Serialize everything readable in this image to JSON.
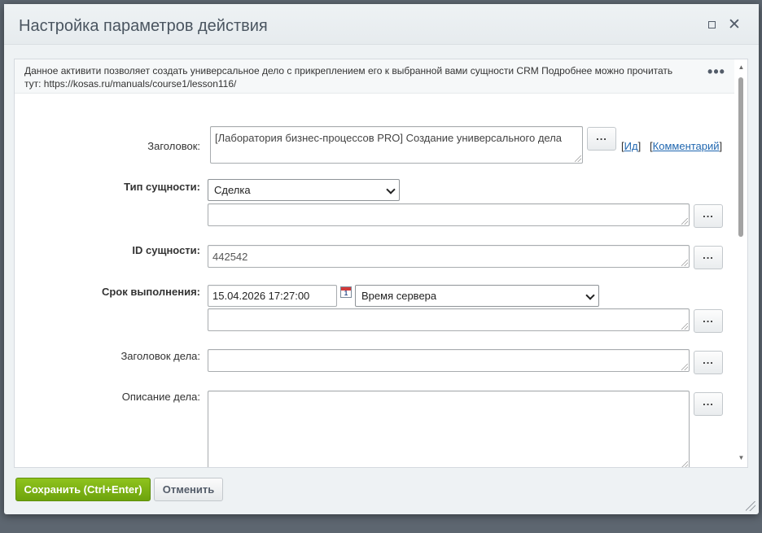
{
  "dialog": {
    "title": "Настройка параметров действия",
    "maximize_icon": "maximize-icon",
    "close_icon": "close-icon",
    "close_glyph": "✕"
  },
  "info": {
    "text": "Данное активити позволяет создать универсальное дело с прикреплением его к выбранной вами сущности CRM Подробнее можно прочитать тут: https://kosas.ru/manuals/course1/lesson116/",
    "more_glyph": "•••"
  },
  "form": {
    "title_label": "Заголовок:",
    "title_value": "[Лаборатория бизнес-процессов PRO] Создание универсального дела",
    "dots": "...",
    "id_link_open": "[",
    "id_link": "Ид",
    "id_link_close": "]",
    "comment_link_open": "[",
    "comment_link": "Комментарий",
    "comment_link_close": "]",
    "entity_type_label": "Тип сущности:",
    "entity_type_value": "Сделка",
    "entity_type_extra": "",
    "entity_id_label": "ID сущности:",
    "entity_id_value": "442542",
    "deadline_label": "Срок выполнения:",
    "deadline_value": "15.04.2026 17:27:00",
    "calendar_day": "1",
    "timezone_value": "Время сервера",
    "deadline_extra": "",
    "activity_title_label": "Заголовок дела:",
    "activity_title_value": "",
    "activity_desc_label": "Описание дела:",
    "activity_desc_value": ""
  },
  "footer": {
    "save_label": "Сохранить (Ctrl+Enter)",
    "cancel_label": "Отменить"
  },
  "colors": {
    "save_button": "#7ab317",
    "link": "#2067b0",
    "overlay": "#5d6670"
  }
}
